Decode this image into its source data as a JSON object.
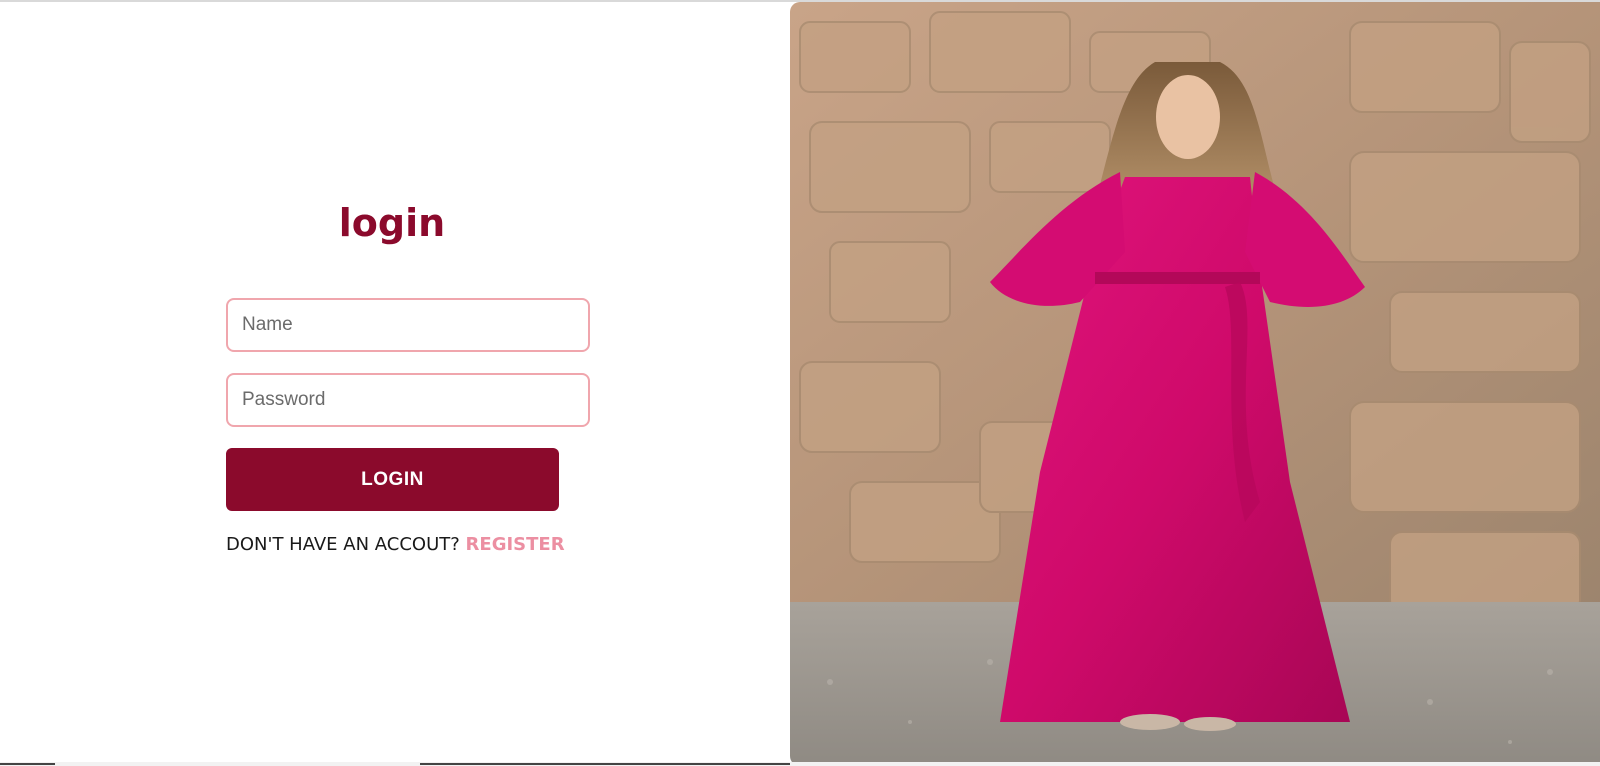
{
  "login": {
    "title": "login",
    "name_placeholder": "Name",
    "password_placeholder": "Password",
    "button_label": "LOGIN",
    "no_account_text": "DON'T HAVE AN ACCOUT?",
    "register_link": "REGISTER"
  },
  "colors": {
    "brand": "#8b0a2c",
    "field_border": "#f0a6ad",
    "link": "#ec8fa2"
  },
  "hero_image": {
    "subject": "woman in pink wrap dress against stone wall"
  }
}
